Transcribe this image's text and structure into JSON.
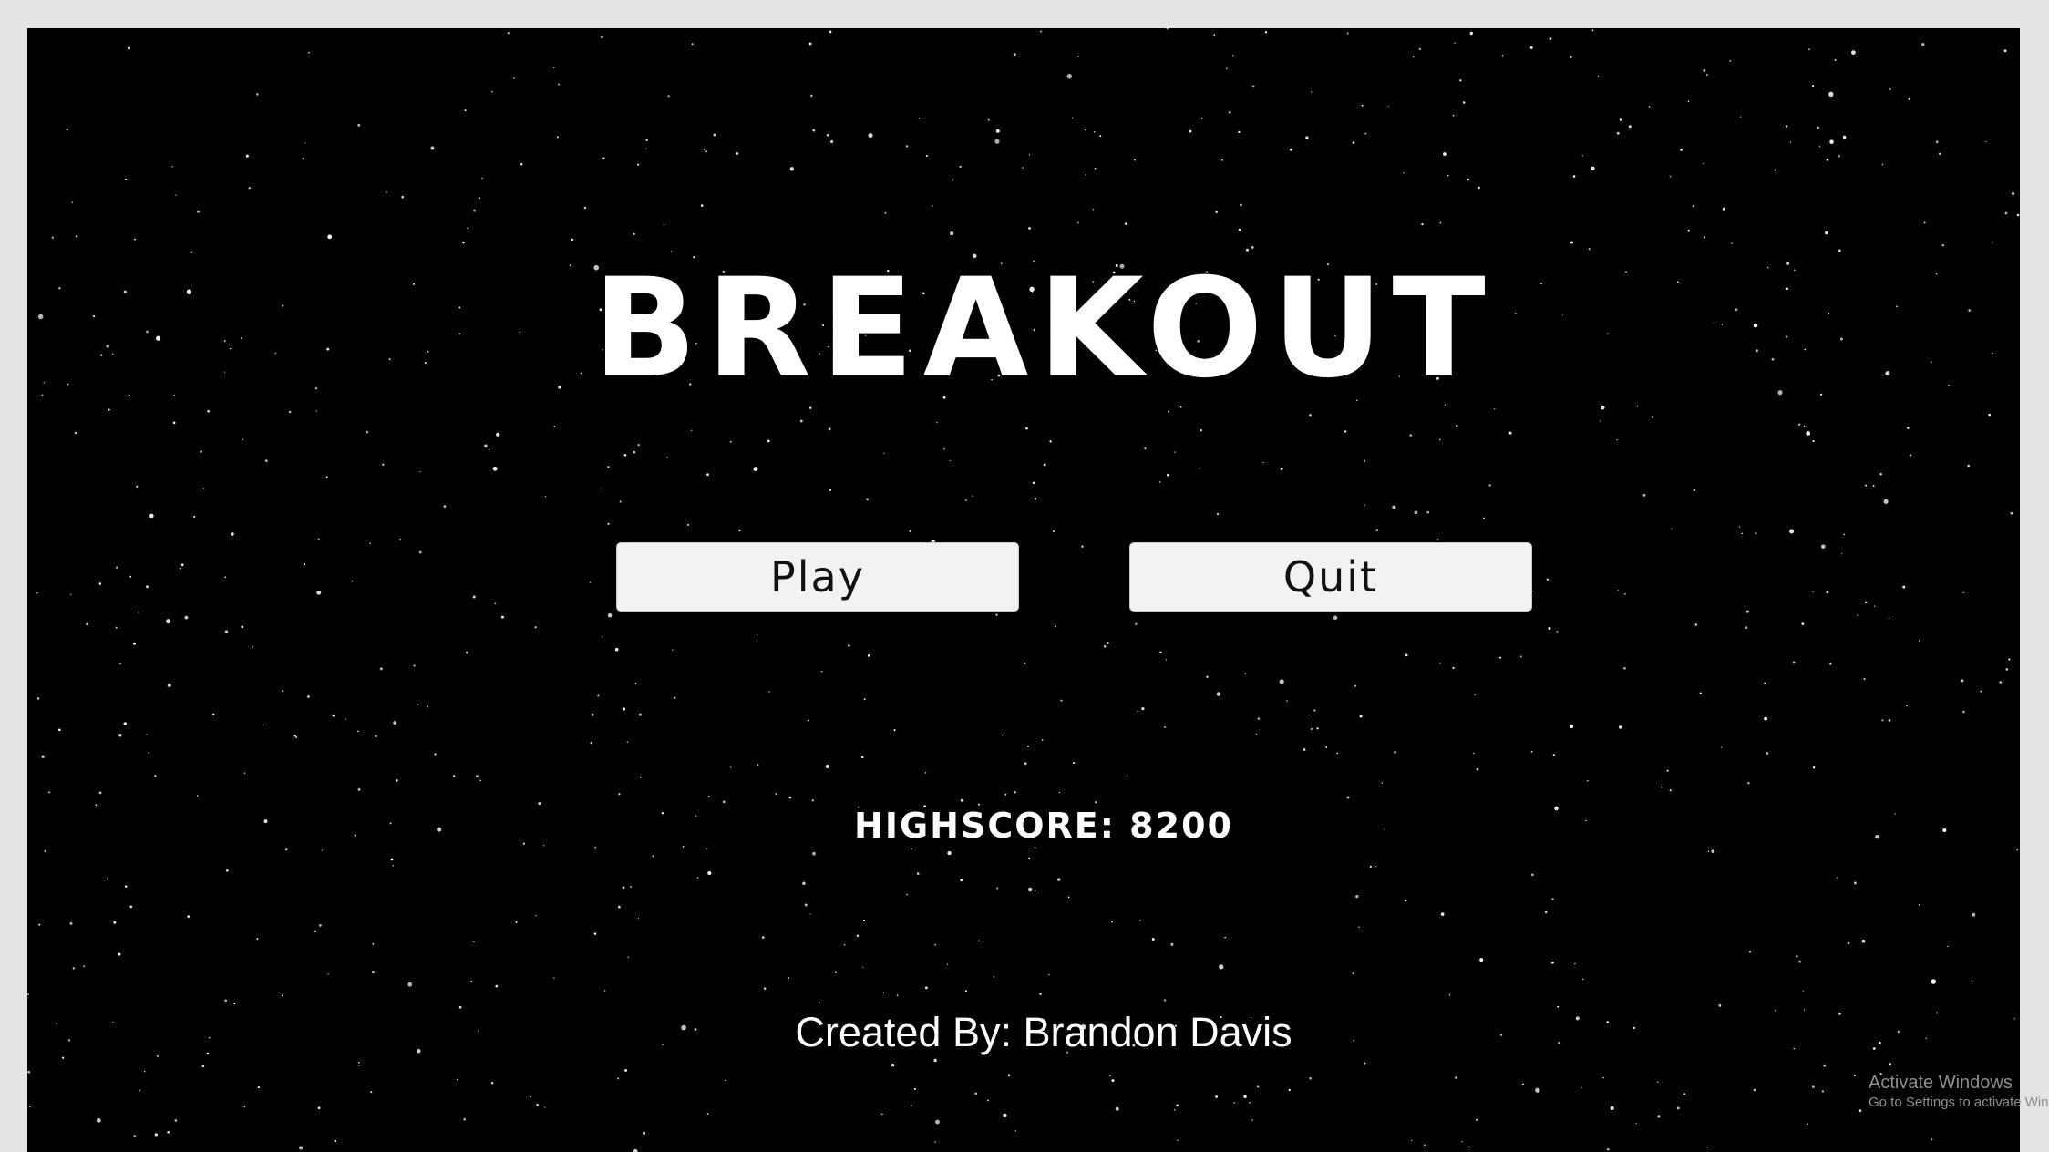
{
  "game": {
    "title": "BREAKOUT",
    "buttons": {
      "play_label": "Play",
      "quit_label": "Quit"
    },
    "highscore_text": "HIGHSCORE: 8200",
    "credits_text": "Created By: Brandon Davis"
  },
  "os_watermark": {
    "title": "Activate Windows",
    "subtitle": "Go to Settings to activate Windows."
  },
  "colors": {
    "background": "#000000",
    "window_frame": "#e3e4e3",
    "button_fill": "#f2f2f2",
    "text": "#ffffff"
  }
}
